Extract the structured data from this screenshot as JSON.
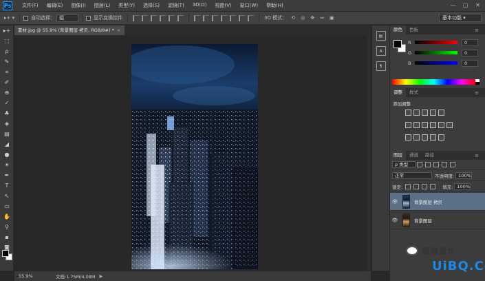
{
  "app": {
    "logo": "Ps",
    "window_controls": [
      "—",
      "▢",
      "✕"
    ]
  },
  "menubar": {
    "items": [
      "文件(F)",
      "编辑(E)",
      "图像(I)",
      "图层(L)",
      "类型(Y)",
      "选择(S)",
      "滤镜(T)",
      "3D(D)",
      "视图(V)",
      "窗口(W)",
      "帮助(H)"
    ]
  },
  "options": {
    "auto_select_label": "自动选择：",
    "auto_select_value": "组",
    "show_transform_label": "显示变换控件",
    "mode_3d_label": "3D 模式：",
    "workspace": "基本功能"
  },
  "document": {
    "tab_title": "素材.jpg @ 55.9% (背景图层 拷贝, RGB/8#) *",
    "close": "×"
  },
  "status": {
    "zoom": "55.9%",
    "doc_info": "文档:1.75M/4.08M",
    "arrow": "▶"
  },
  "tools": [
    "▸+",
    "⬚",
    "ρ",
    "✎",
    "⌗",
    "✐",
    "⊕",
    "✓",
    "♣",
    "◈",
    "▤",
    "◢",
    "●",
    "☀",
    "✒",
    "T",
    "↖",
    "▭",
    "✋",
    "⚲",
    "▪",
    "◙"
  ],
  "dock": {
    "icons": [
      "▤",
      "A",
      "¶"
    ]
  },
  "color_panel": {
    "tabs": [
      "颜色",
      "色板"
    ],
    "channels": [
      {
        "label": "R",
        "value": "0",
        "gradient": "linear-gradient(90deg,#000,#ff0000)"
      },
      {
        "label": "G",
        "value": "0",
        "gradient": "linear-gradient(90deg,#000,#00ff00)"
      },
      {
        "label": "B",
        "value": "0",
        "gradient": "linear-gradient(90deg,#000,#0000ff)"
      }
    ]
  },
  "adjustments_panel": {
    "tabs": [
      "调整",
      "样式"
    ],
    "title": "添加调整"
  },
  "layers_panel": {
    "tabs": [
      "图层",
      "通道",
      "路径"
    ],
    "filter_kind": "ρ 类型",
    "blend_mode": "正常",
    "opacity_label": "不透明度:",
    "opacity_value": "100%",
    "lock_label": "锁定:",
    "fill_label": "填充:",
    "fill_value": "100%",
    "layers": [
      {
        "name": "背景图层 拷贝",
        "visible": "👁",
        "active": true
      },
      {
        "name": "背景图层",
        "visible": "👁",
        "active": false
      }
    ]
  },
  "watermark": {
    "name": "极微设计",
    "site": "UiBQ.CoM"
  },
  "colors": {
    "accent_blue": "#31a8ff",
    "selected_layer": "#5b6f86"
  }
}
